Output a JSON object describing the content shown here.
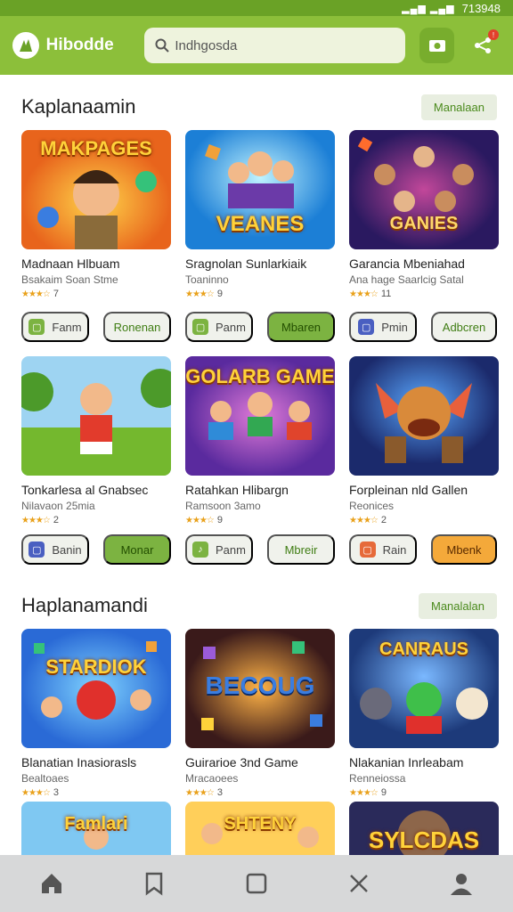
{
  "status": {
    "time": "713948"
  },
  "app": {
    "title": "Hibodde"
  },
  "search": {
    "value": "Indhgosda"
  },
  "sections": [
    {
      "title": "Kaplanaamin",
      "more_label": "Manalaan",
      "cards": [
        {
          "banner": "MAKPAGES",
          "title": "Madnaan Hlbuam",
          "sub": "Bsakaim Soan Stme",
          "rating": "7"
        },
        {
          "banner": "VEANES",
          "title": "Sragnolan Sunlarkiaik",
          "sub": "Toaninno",
          "rating": "9"
        },
        {
          "banner": "GANIES",
          "title": "Garancia Mbeniahad",
          "sub": "Ana hage Saarlcig Satal",
          "rating": "11"
        },
        {
          "banner": "",
          "title": "Tonkarlesa al Gnabsec",
          "sub": "Nilavaon 25mia",
          "rating": "2"
        },
        {
          "banner": "GOLARB GAME",
          "title": "Ratahkan Hlibargn",
          "sub": "Ramsoon 3amo",
          "rating": "9"
        },
        {
          "banner": "",
          "title": "Forpleinan nld Gallen",
          "sub": "Reonices",
          "rating": "2"
        }
      ],
      "buttons_row1": [
        {
          "label": "Fanm",
          "style": "plain"
        },
        {
          "label": "Ronenan",
          "style": "outline"
        },
        {
          "label": "Panm",
          "style": "plain"
        },
        {
          "label": "Mbaren",
          "style": "green"
        },
        {
          "label": "Pmin",
          "style": "plain"
        },
        {
          "label": "Adbcren",
          "style": "outline"
        }
      ],
      "buttons_row2": [
        {
          "label": "Banin",
          "style": "plain"
        },
        {
          "label": "Monar",
          "style": "green"
        },
        {
          "label": "Panm",
          "style": "plain"
        },
        {
          "label": "Mbreir",
          "style": "outline"
        },
        {
          "label": "Rain",
          "style": "plain"
        },
        {
          "label": "Mbenk",
          "style": "orange"
        }
      ]
    },
    {
      "title": "Haplanamandi",
      "more_label": "Manalalan",
      "cards": [
        {
          "banner": "STARDIOK",
          "title": "Blanatian Inasiorasls",
          "sub": "Bealtoaes",
          "rating": "3"
        },
        {
          "banner": "BECOUG",
          "title": "Guirarioe 3nd Game",
          "sub": "Mracaoees",
          "rating": "3"
        },
        {
          "banner": "CANRAUS",
          "title": "Nlakanian Inrleabam",
          "sub": "Renneiossa",
          "rating": "9"
        },
        {
          "banner": "Famlari",
          "title": "",
          "sub": "",
          "rating": ""
        },
        {
          "banner": "SHTENY",
          "title": "",
          "sub": "",
          "rating": ""
        },
        {
          "banner": "SYLCDAS",
          "title": "",
          "sub": "",
          "rating": ""
        }
      ]
    }
  ],
  "colors": {
    "brand": "#8cbf3a",
    "accent_green": "#7cb341",
    "accent_orange": "#f4a93a",
    "star": "#e9a11b"
  },
  "nav": [
    "home-icon",
    "bookmark-icon",
    "square-icon",
    "close-icon",
    "profile-icon"
  ]
}
